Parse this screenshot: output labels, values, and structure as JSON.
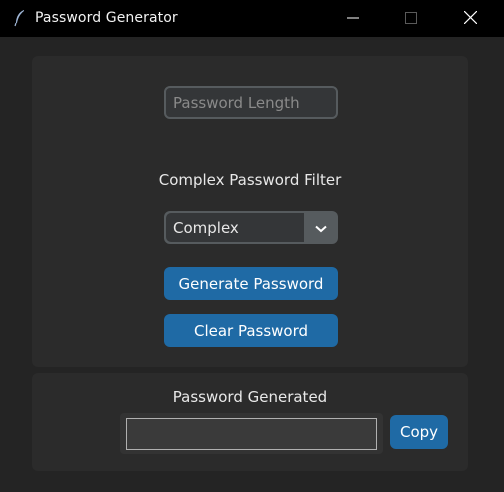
{
  "window": {
    "title": "Password Generator",
    "icon": "feather-icon",
    "controls": [
      "minimize-icon",
      "maximize-icon",
      "close-icon"
    ]
  },
  "form": {
    "length_placeholder": "Password Length",
    "length_value": "",
    "filter_label": "Complex Password Filter",
    "filter_selected": "Complex",
    "generate_label": "Generate Password",
    "clear_label": "Clear Password"
  },
  "output": {
    "label": "Password Generated",
    "value": "",
    "copy_label": "Copy"
  },
  "colors": {
    "accent": "#1f6aa5",
    "background": "#242424",
    "frame": "#2b2b2b",
    "titlebar": "#000000"
  }
}
